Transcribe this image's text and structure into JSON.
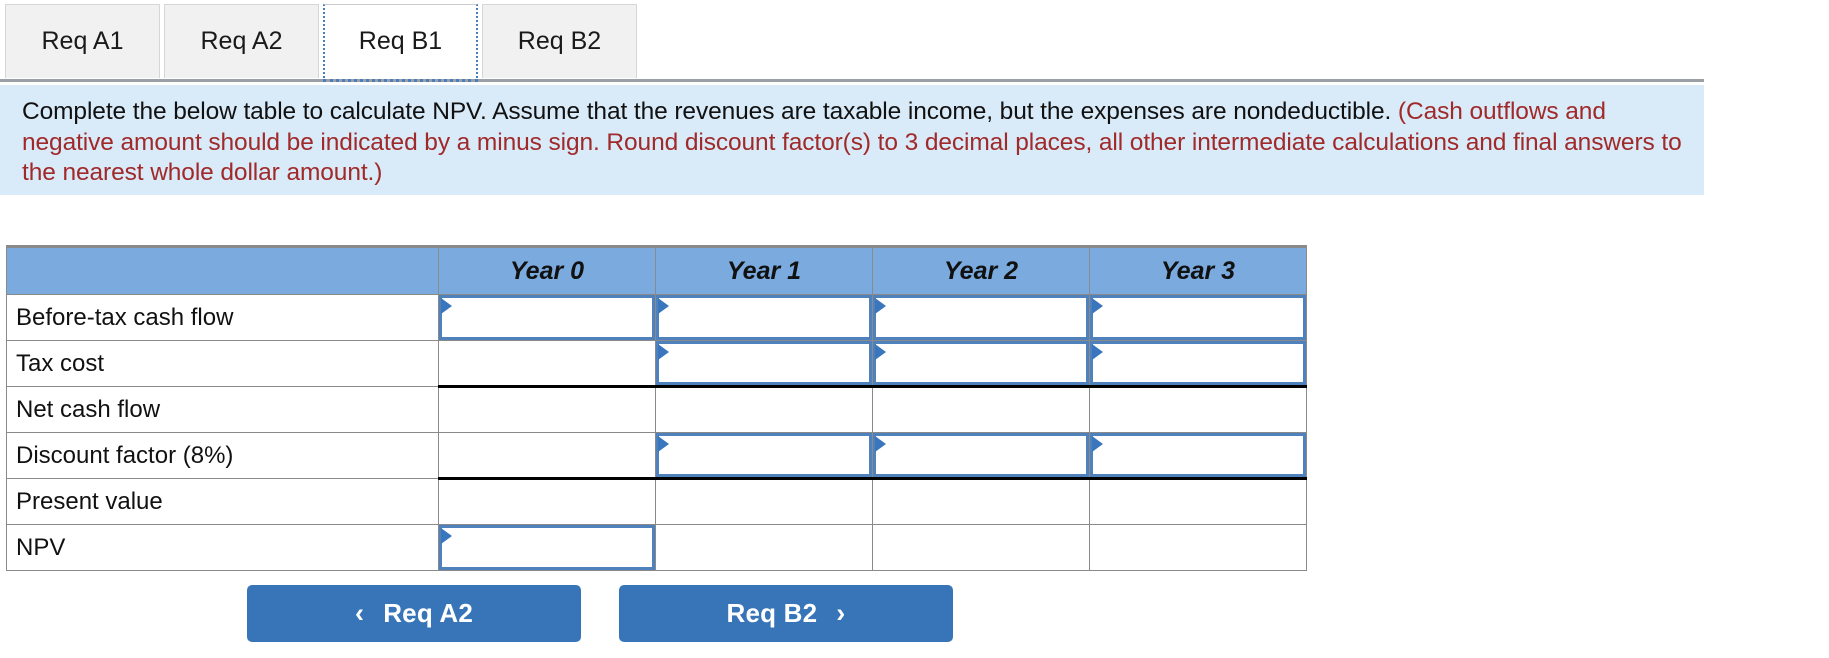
{
  "tabs": [
    {
      "label": "Req A1",
      "active": false
    },
    {
      "label": "Req A2",
      "active": false
    },
    {
      "label": "Req B1",
      "active": true
    },
    {
      "label": "Req B2",
      "active": false
    }
  ],
  "instructions": {
    "main": "Complete the below table to calculate NPV. Assume that the revenues are taxable income, but the expenses are nondeductible.",
    "hint": "(Cash outflows and negative amount should be indicated by a minus sign. Round discount factor(s) to 3 decimal places, all other intermediate calculations and final answers to the nearest whole dollar amount.)",
    "hint_color": "#a02a2a",
    "background_color": "#d9eaf8"
  },
  "table": {
    "header_color": "#7aaade",
    "corner_label": "",
    "columns": [
      "Year 0",
      "Year 1",
      "Year 2",
      "Year 3"
    ],
    "rows": [
      {
        "label": "Before-tax cash flow",
        "values": [
          "",
          "",
          "",
          ""
        ],
        "inputs": [
          true,
          true,
          true,
          true
        ]
      },
      {
        "label": "Tax cost",
        "values": [
          "",
          "",
          "",
          ""
        ],
        "inputs": [
          false,
          true,
          true,
          true
        ]
      },
      {
        "label": "Net cash flow",
        "values": [
          "",
          "",
          "",
          ""
        ],
        "inputs": [
          false,
          false,
          false,
          false
        ]
      },
      {
        "label": "Discount factor (8%)",
        "values": [
          "",
          "",
          "",
          ""
        ],
        "inputs": [
          false,
          true,
          true,
          true
        ]
      },
      {
        "label": "Present value",
        "values": [
          "",
          "",
          "",
          ""
        ],
        "inputs": [
          false,
          false,
          false,
          false
        ]
      },
      {
        "label": "NPV",
        "values": [
          "",
          "",
          "",
          ""
        ],
        "inputs": [
          true,
          false,
          false,
          false
        ]
      }
    ]
  },
  "nav": {
    "prev": {
      "label": "Req A2",
      "icon": "chevron-left-icon",
      "glyph": "‹"
    },
    "next": {
      "label": "Req B2",
      "icon": "chevron-right-icon",
      "glyph": "›"
    },
    "button_color": "#3775b8"
  }
}
